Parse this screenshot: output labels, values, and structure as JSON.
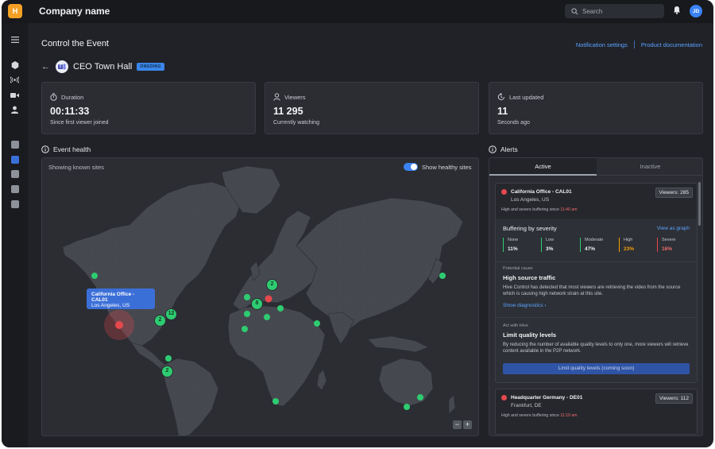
{
  "app": {
    "company": "Company name",
    "logo_letter": "H",
    "search_placeholder": "Search",
    "user_initials": "JD"
  },
  "page": {
    "title": "Control the Event",
    "links": [
      "Notification settings",
      "Product documentation"
    ]
  },
  "event": {
    "name": "CEO Town Hall",
    "status": "ONGOING"
  },
  "stats": [
    {
      "label": "Duration",
      "value": "00:11:33",
      "sub": "Since first viewer joined",
      "icon": "stopwatch-icon"
    },
    {
      "label": "Viewers",
      "value": "11 295",
      "sub": "Currently watching",
      "icon": "person-icon"
    },
    {
      "label": "Last updated",
      "value": "11",
      "sub": "Seconds ago",
      "icon": "refresh-clock-icon"
    }
  ],
  "event_health": {
    "title": "Event health",
    "subtitle": "Showing known sites",
    "toggle_label": "Show healthy sites",
    "toggle_on": true,
    "tooltip": {
      "title": "California Office - CAL01",
      "location": "Los Angeles, US"
    },
    "zoom": [
      "−",
      "+"
    ],
    "clusters": [
      "2",
      "8",
      "12",
      "2",
      "2"
    ]
  },
  "alerts": {
    "title": "Alerts",
    "tabs": [
      "Active",
      "Inactive"
    ],
    "items": [
      {
        "title": "California Office - CAL01",
        "location": "Los Angeles, US",
        "viewers": "Viewers: 285",
        "note": "High and severe buffering since",
        "time": "11:40 am",
        "severity_title": "Buffering by severity",
        "view_graph": "View as graph",
        "severity": [
          {
            "name": "None",
            "pct": "11%",
            "color": "#2ecc71"
          },
          {
            "name": "Low",
            "pct": "3%",
            "color": "#2ecc71"
          },
          {
            "name": "Moderate",
            "pct": "47%",
            "color": "#2ecc71"
          },
          {
            "name": "High",
            "pct": "23%",
            "color": "#f59e0b"
          },
          {
            "name": "Severe",
            "pct": "16%",
            "color": "#e5484d"
          }
        ],
        "cause_label": "Potential cause",
        "cause_title": "High source traffic",
        "cause_text": "Hive Control has detected that most viewers are retrieving the video from the source which is causing high network strain at this site.",
        "diag_link": "Show diagnostics",
        "act_label": "Act with Hive",
        "act_title": "Limit quality levels",
        "act_text": "By reducing the number of available quality levels to only one, more viewers will retrieve content available in the P2P network.",
        "act_button": "Limit quality levels (coming soon)"
      },
      {
        "title": "Headquarter Germany - DE01",
        "location": "Frankfurt, DE",
        "viewers": "Viewers: 112",
        "note": "High and severe buffering since",
        "time": "11:10 am"
      }
    ]
  }
}
